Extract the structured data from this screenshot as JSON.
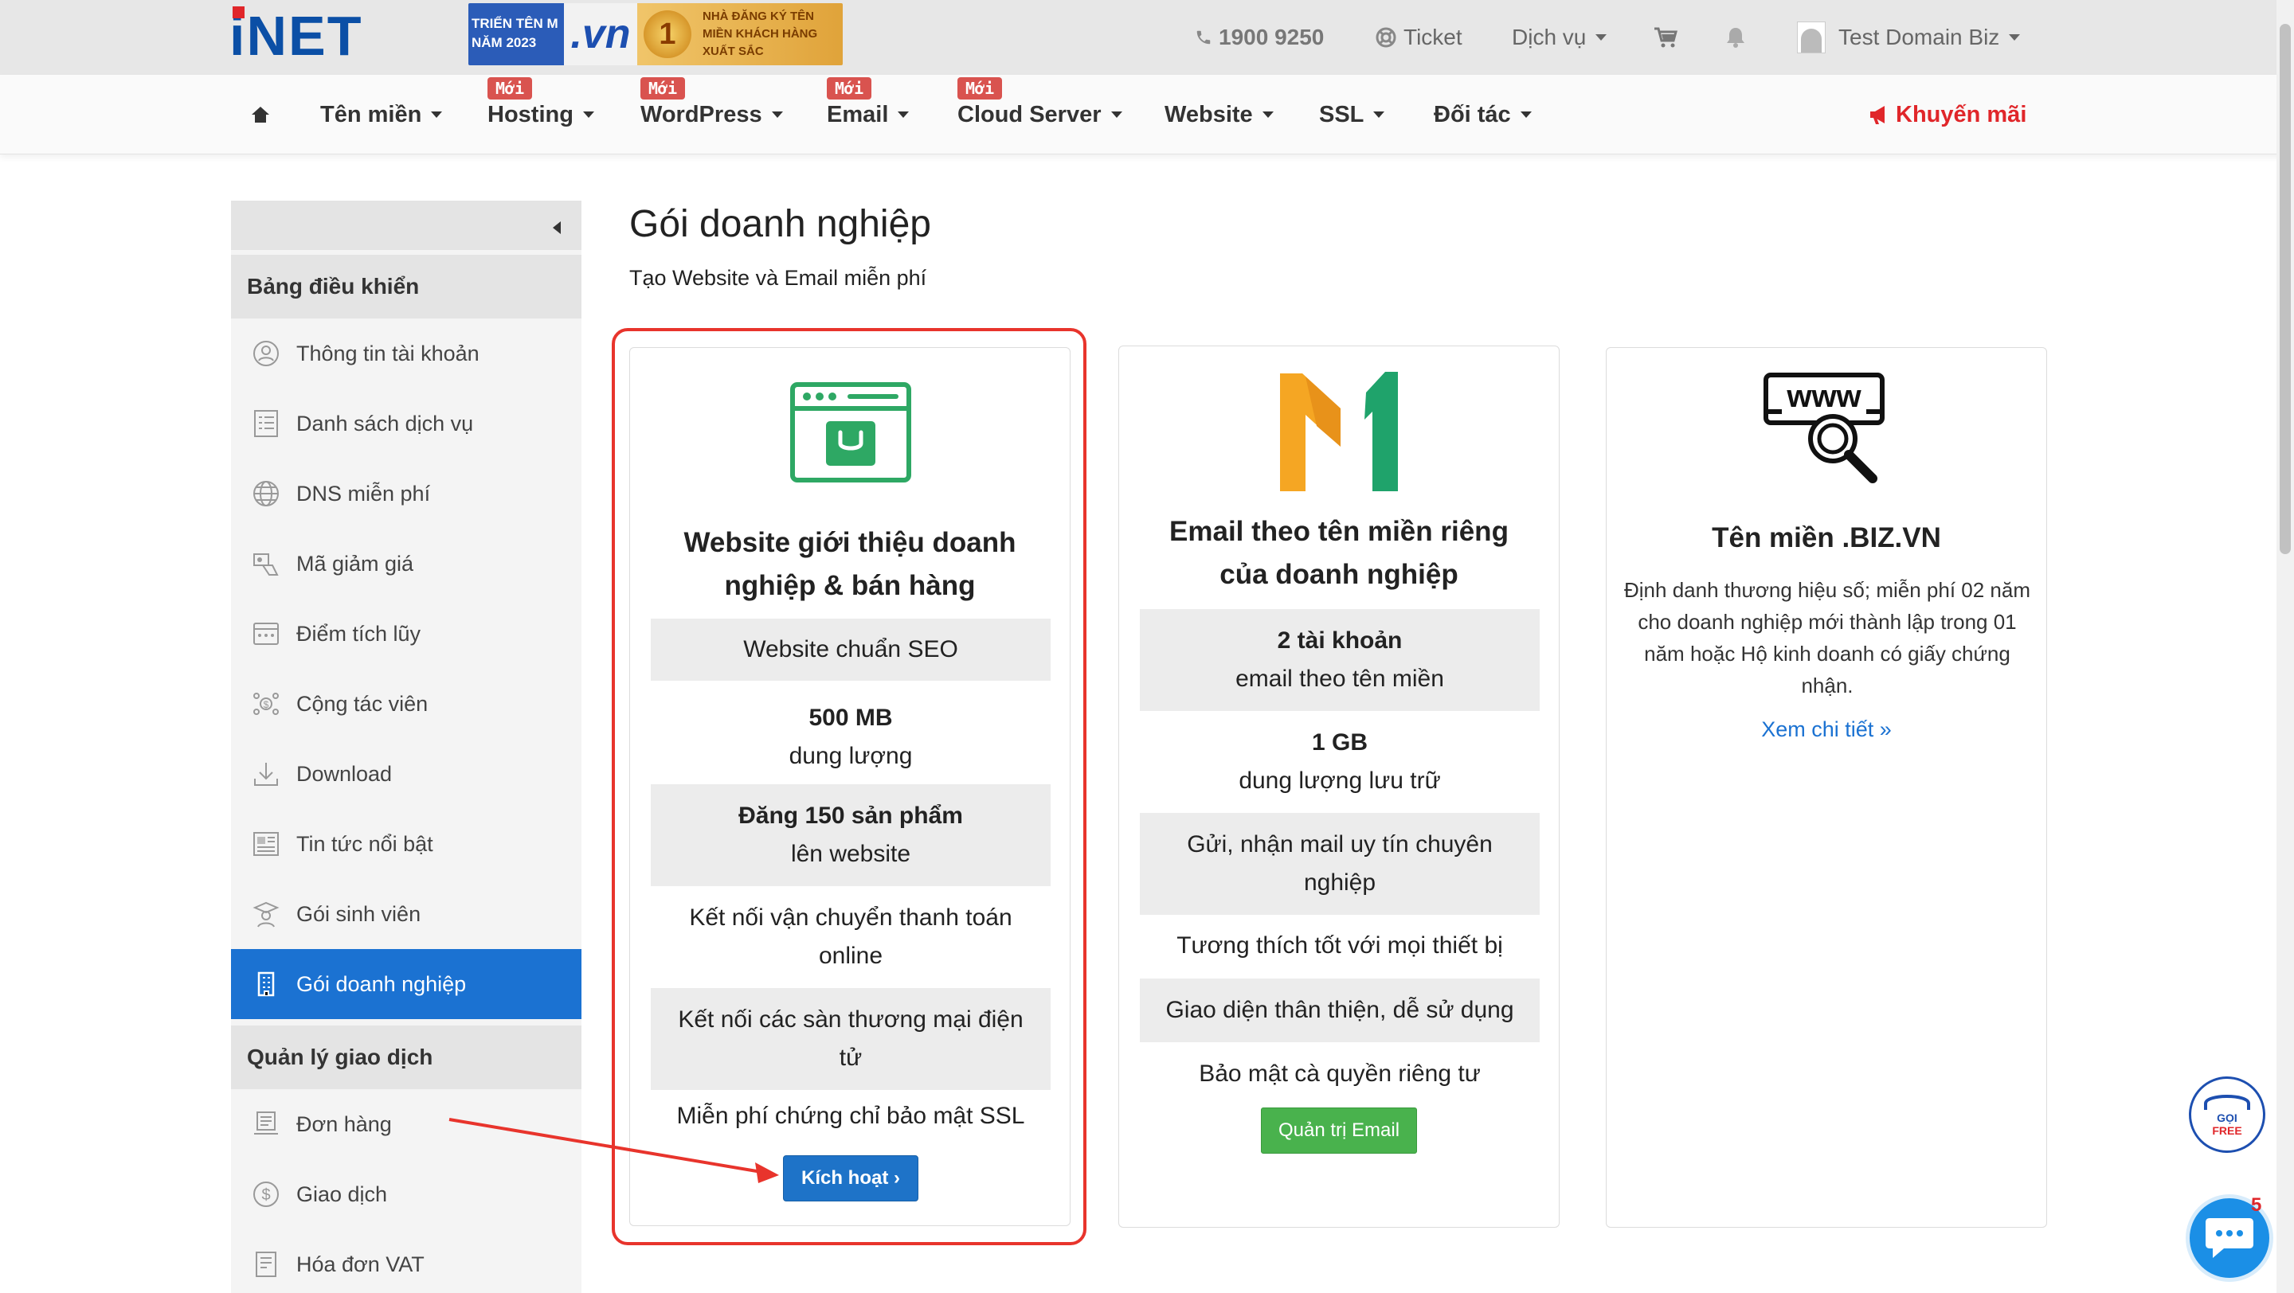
{
  "brand": {
    "logo_text_a": "i",
    "logo_text_b": "NET"
  },
  "banner": {
    "left_text": "TRIỂN TÊN M NĂM 2023",
    "vn_text": ".vn",
    "medal": "1",
    "right_text": "NHÀ ĐĂNG KÝ TÊN MIỀN KHÁCH HÀNG XUẤT SẮC"
  },
  "topbar": {
    "phone": "1900 9250",
    "ticket": "Ticket",
    "services": "Dịch vụ",
    "user": "Test Domain Biz"
  },
  "nav": {
    "badge": "Mới",
    "items": [
      {
        "label": "Tên miền",
        "new": false
      },
      {
        "label": "Hosting",
        "new": true
      },
      {
        "label": "WordPress",
        "new": true
      },
      {
        "label": "Email",
        "new": true
      },
      {
        "label": "Cloud Server",
        "new": true
      },
      {
        "label": "Website",
        "new": false
      },
      {
        "label": "SSL",
        "new": false
      },
      {
        "label": "Đối tác",
        "new": false
      }
    ],
    "promo": "Khuyến mãi"
  },
  "sidebar": {
    "section1": "Bảng điều khiển",
    "items": [
      {
        "label": "Thông tin tài khoản",
        "icon": "user-icon"
      },
      {
        "label": "Danh sách dịch vụ",
        "icon": "list-icon"
      },
      {
        "label": "DNS miễn phí",
        "icon": "globe-icon"
      },
      {
        "label": "Mã giảm giá",
        "icon": "coupon-icon"
      },
      {
        "label": "Điểm tích lũy",
        "icon": "points-icon"
      },
      {
        "label": "Cộng tác viên",
        "icon": "affiliate-icon"
      },
      {
        "label": "Download",
        "icon": "download-icon"
      },
      {
        "label": "Tin tức nổi bật",
        "icon": "news-icon"
      },
      {
        "label": "Gói sinh viên",
        "icon": "student-icon"
      },
      {
        "label": "Gói doanh nghiệp",
        "icon": "building-icon"
      }
    ],
    "section2": "Quản lý giao dịch",
    "items2": [
      {
        "label": "Đơn hàng",
        "icon": "order-icon"
      },
      {
        "label": "Giao dịch",
        "icon": "dollar-icon"
      },
      {
        "label": "Hóa đơn VAT",
        "icon": "invoice-icon"
      }
    ]
  },
  "main": {
    "title": "Gói doanh nghiệp",
    "subtitle": "Tạo Website và Email miễn phí"
  },
  "card_website": {
    "title_line1": "Website giới thiệu doanh",
    "title_line2": "nghiệp & bán hàng",
    "f1": "Website chuẩn SEO",
    "f2_a": "500 MB",
    "f2_b": "dung lượng",
    "f3_a": "Đăng 150 sản phẩm",
    "f3_b": "lên website",
    "f4_a": "Kết nối vận chuyển thanh toán",
    "f4_b": "online",
    "f5_a": "Kết nối các sàn thương mại điện",
    "f5_b": "tử",
    "f6": "Miễn phí chứng chỉ bảo mật SSL",
    "button": "Kích hoạt ›"
  },
  "card_email": {
    "title_line1": "Email theo tên miền riêng",
    "title_line2": "của doanh nghiệp",
    "f1_a": "2 tài khoản",
    "f1_b": "email theo tên miền",
    "f2_a": "1 GB",
    "f2_b": "dung lượng lưu trữ",
    "f3_a": "Gửi, nhận mail uy tín chuyên",
    "f3_b": "nghiệp",
    "f4": "Tương thích tốt với mọi thiết bị",
    "f5": "Giao diện thân thiện, dễ sử dụng",
    "f6": "Bảo mật cà quyền riêng tư",
    "button": "Quản trị Email"
  },
  "card_domain": {
    "logo_text": "www",
    "title": "Tên miền .BIZ.VN",
    "desc": "Định danh thương hiệu số; miễn phí 02 năm cho doanh nghiệp mới thành lập trong 01 năm hoặc Hộ kinh doanh có giấy chứng nhận.",
    "link": "Xem chi tiết »"
  },
  "widgets": {
    "goi_free_a": "GỌI",
    "goi_free_b": "FREE",
    "chat_count": "5"
  },
  "colors": {
    "brand_blue": "#0b4fa6",
    "brand_red": "#e0262a",
    "active_blue": "#1b72d2",
    "highlight_red": "#e8342c",
    "success_green": "#49b24d"
  }
}
